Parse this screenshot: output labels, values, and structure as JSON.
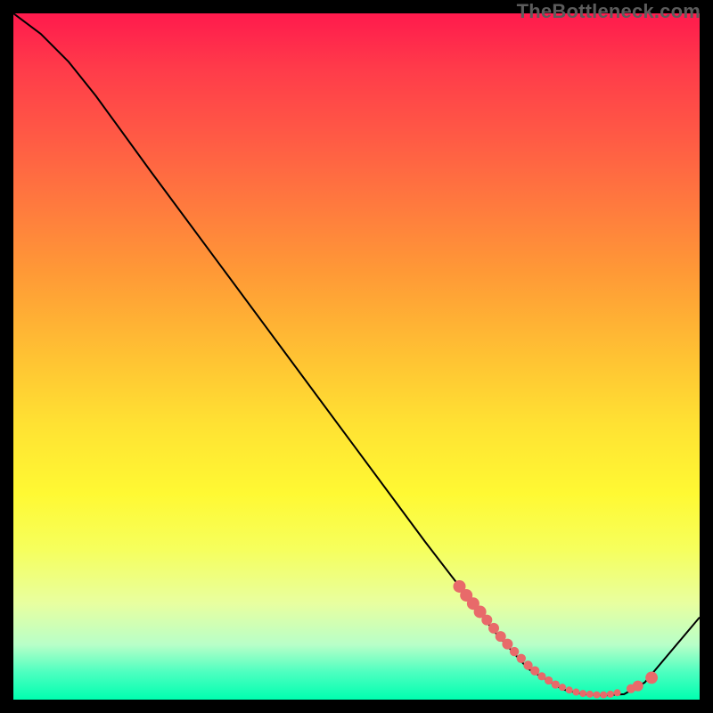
{
  "watermark": "TheBottleneck.com",
  "chart_data": {
    "type": "line",
    "title": "",
    "xlabel": "",
    "ylabel": "",
    "xlim": [
      0,
      100
    ],
    "ylim": [
      0,
      100
    ],
    "series": [
      {
        "name": "curve",
        "x": [
          0,
          4,
          8,
          12,
          20,
          30,
          40,
          50,
          60,
          65,
          70,
          75,
          80,
          83,
          86,
          89,
          92,
          100
        ],
        "y": [
          100,
          97,
          93,
          88,
          77,
          63.5,
          50,
          36.5,
          23,
          16.5,
          10,
          4.5,
          1.5,
          0.8,
          0.6,
          0.8,
          2.5,
          12
        ]
      }
    ],
    "markers": {
      "name": "highlight-points",
      "color": "#e86a6a",
      "sizes_small_to_large": true,
      "x": [
        65,
        66,
        67,
        68,
        69,
        70,
        71,
        72,
        73,
        74,
        75,
        76,
        77,
        78,
        79,
        80,
        81,
        82,
        83,
        84,
        85,
        86,
        87,
        88,
        90,
        91,
        93
      ],
      "y": [
        16.5,
        15.2,
        14.0,
        12.8,
        11.6,
        10.4,
        9.2,
        8.1,
        7.0,
        6.0,
        5.0,
        4.2,
        3.4,
        2.8,
        2.2,
        1.8,
        1.4,
        1.1,
        0.9,
        0.8,
        0.7,
        0.7,
        0.8,
        1.0,
        1.6,
        2.0,
        3.2
      ]
    }
  }
}
